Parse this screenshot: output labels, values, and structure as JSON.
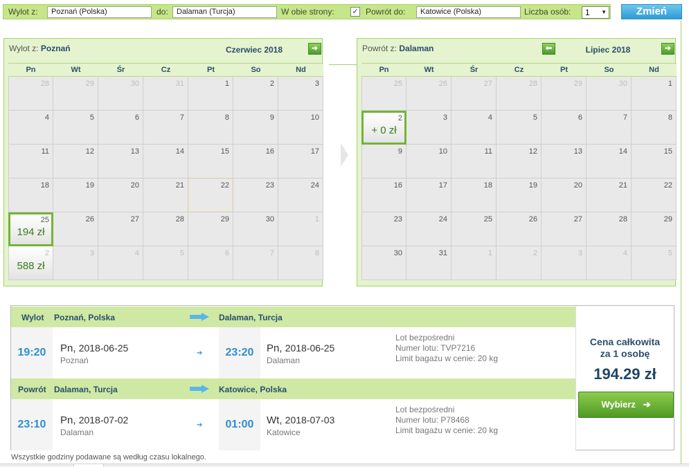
{
  "search": {
    "from_label": "Wylot z:",
    "from_value": "Poznań (Polska)",
    "to_label": "do:",
    "to_value": "Dalaman (Turcja)",
    "roundtrip_label": "W obie strony:",
    "roundtrip_checked": true,
    "roundtrip_mark": "✓",
    "return_label": "Powrót do:",
    "return_value": "Katowice (Polska)",
    "persons_label": "Liczba osób:",
    "persons_value": "1",
    "change_button": "Zmień"
  },
  "calendars": [
    {
      "label_prefix": "Wylot z:",
      "city": "Poznań",
      "month": "Czerwiec 2018",
      "weekdays": [
        "Pn",
        "Wt",
        "Śr",
        "Cz",
        "Pt",
        "So",
        "Nd"
      ],
      "days": [
        {
          "day": "28",
          "off": true
        },
        {
          "day": "29",
          "off": true
        },
        {
          "day": "30",
          "off": true
        },
        {
          "day": "31",
          "off": true
        },
        {
          "day": "1"
        },
        {
          "day": "2"
        },
        {
          "day": "3"
        },
        {
          "day": "4"
        },
        {
          "day": "5"
        },
        {
          "day": "6"
        },
        {
          "day": "7"
        },
        {
          "day": "8"
        },
        {
          "day": "9"
        },
        {
          "day": "10"
        },
        {
          "day": "11"
        },
        {
          "day": "12"
        },
        {
          "day": "13"
        },
        {
          "day": "14"
        },
        {
          "day": "15"
        },
        {
          "day": "16"
        },
        {
          "day": "17"
        },
        {
          "day": "18"
        },
        {
          "day": "19"
        },
        {
          "day": "20"
        },
        {
          "day": "21"
        },
        {
          "day": "22",
          "today": true
        },
        {
          "day": "23"
        },
        {
          "day": "24"
        },
        {
          "day": "25",
          "price": "194 zł",
          "selected": true
        },
        {
          "day": "26"
        },
        {
          "day": "27"
        },
        {
          "day": "28"
        },
        {
          "day": "29"
        },
        {
          "day": "30"
        },
        {
          "day": "1",
          "off": true
        },
        {
          "day": "2",
          "off": true,
          "price": "588 zł"
        },
        {
          "day": "3",
          "off": true
        },
        {
          "day": "4",
          "off": true
        },
        {
          "day": "5",
          "off": true
        },
        {
          "day": "6",
          "off": true
        },
        {
          "day": "7",
          "off": true
        },
        {
          "day": "8",
          "off": true
        }
      ]
    },
    {
      "label_prefix": "Powrót z:",
      "city": "Dalaman",
      "month": "Lipiec 2018",
      "weekdays": [
        "Pn",
        "Wt",
        "Śr",
        "Cz",
        "Pt",
        "So",
        "Nd"
      ],
      "days": [
        {
          "day": "25",
          "off": true
        },
        {
          "day": "26",
          "off": true
        },
        {
          "day": "27",
          "off": true
        },
        {
          "day": "28",
          "off": true
        },
        {
          "day": "29",
          "off": true
        },
        {
          "day": "30",
          "off": true
        },
        {
          "day": "1"
        },
        {
          "day": "2",
          "price": "+ 0 zł",
          "selected": true
        },
        {
          "day": "3"
        },
        {
          "day": "4"
        },
        {
          "day": "5"
        },
        {
          "day": "6"
        },
        {
          "day": "7"
        },
        {
          "day": "8"
        },
        {
          "day": "9"
        },
        {
          "day": "10"
        },
        {
          "day": "11"
        },
        {
          "day": "12"
        },
        {
          "day": "13"
        },
        {
          "day": "14"
        },
        {
          "day": "15"
        },
        {
          "day": "16"
        },
        {
          "day": "17"
        },
        {
          "day": "18"
        },
        {
          "day": "19"
        },
        {
          "day": "20"
        },
        {
          "day": "21"
        },
        {
          "day": "22"
        },
        {
          "day": "23"
        },
        {
          "day": "24"
        },
        {
          "day": "25"
        },
        {
          "day": "26"
        },
        {
          "day": "27"
        },
        {
          "day": "28"
        },
        {
          "day": "29"
        },
        {
          "day": "30"
        },
        {
          "day": "31"
        },
        {
          "day": "1",
          "off": true
        },
        {
          "day": "2",
          "off": true
        },
        {
          "day": "3",
          "off": true
        },
        {
          "day": "4",
          "off": true
        },
        {
          "day": "5",
          "off": true
        }
      ]
    }
  ],
  "outbound": {
    "label": "Wylot",
    "from": "Poznań, Polska",
    "to": "Dalaman, Turcja",
    "dep_time": "19:20",
    "dep_dow": "Pn,",
    "dep_date": "2018-06-25",
    "dep_city": "Poznań",
    "arr_time": "23:20",
    "arr_dow": "Pn,",
    "arr_date": "2018-06-25",
    "arr_city": "Dalaman",
    "info_direct": "Lot bezpośredni",
    "info_flight": "Numer lotu: TVP7216",
    "info_baggage": "Limit bagażu w cenie: 20 kg"
  },
  "inbound": {
    "label": "Powrót",
    "from": "Dalaman, Turcja",
    "to": "Katowice, Polska",
    "dep_time": "23:10",
    "dep_dow": "Pn,",
    "dep_date": "2018-07-02",
    "dep_city": "Dalaman",
    "arr_time": "01:00",
    "arr_dow": "Wt,",
    "arr_date": "2018-07-03",
    "arr_city": "Katowice",
    "info_direct": "Lot bezpośredni",
    "info_flight": "Numer lotu: P78468",
    "info_baggage": "Limit bagażu w cenie: 20 kg"
  },
  "price": {
    "label_line1": "Cena całkowita",
    "label_line2": "za 1 osobę",
    "total": "194.29 zł",
    "choose_button": "Wybierz"
  },
  "footnote": "Wszystkie godziny podawane są według czasu lokalnego.",
  "icons": {
    "nav_prev": "arrow-left-icon",
    "nav_next": "arrow-right-icon",
    "route_arrow": "route-arrow-icon",
    "small_arrow": "small-arrow-icon"
  },
  "colors": {
    "accent_green": "#72b43a",
    "header_green": "#cfe9a4",
    "time_blue": "#2e8fcf",
    "button_blue": "#2f9bd3"
  }
}
